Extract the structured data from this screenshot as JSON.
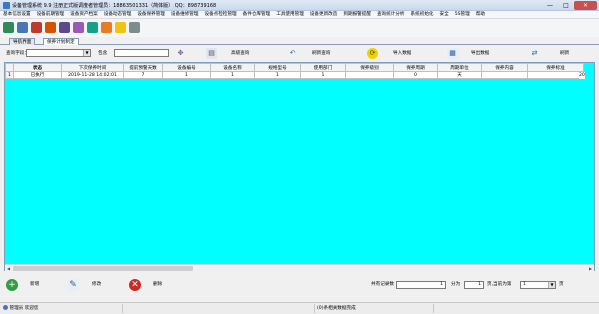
{
  "window": {
    "title": "设备管理系统 9.9   注册正式版调度者管理员：18863501331（简体版）       QQ：898739168",
    "min": "—",
    "max": "□",
    "close": "✕"
  },
  "menu": [
    "基本信息设置",
    "设备前期管理",
    "设备资产档案",
    "设备动态管理",
    "设备保养管理",
    "设备维修管理",
    "设备点检检管理",
    "备件仓库管理",
    "工具使用管理",
    "设备更新改造",
    "到期报警提醒",
    "查询统计分析",
    "系统初始化",
    "安全",
    "5S管理",
    "帮助"
  ],
  "toolbar_icons": [
    {
      "name": "tree-icon",
      "color": "#2e8b57"
    },
    {
      "name": "users-icon",
      "color": "#4a76b8"
    },
    {
      "name": "umbrella-icon",
      "color": "#c0392b"
    },
    {
      "name": "truck-icon",
      "color": "#d35400"
    },
    {
      "name": "person-icon",
      "color": "#5b4b8a"
    },
    {
      "name": "palette-icon",
      "color": "#9b59b6"
    },
    {
      "name": "book-icon",
      "color": "#16a085"
    },
    {
      "name": "gift-icon",
      "color": "#e67e22"
    },
    {
      "name": "worker-icon",
      "color": "#f1c40f"
    },
    {
      "name": "exit-icon",
      "color": "#7f8c8d"
    }
  ],
  "tabs": [
    "导航界面",
    "保养计划制定"
  ],
  "query": {
    "field_label": "查询字段：",
    "field_value": "",
    "contains_label": "包含",
    "keyword": "",
    "advanced_label": "高级查询",
    "refresh_label": "刷新查询",
    "import_label": "导入数据",
    "export_label": "导出数据",
    "reload_label": "刷新"
  },
  "table": {
    "columns": [
      "",
      "状态",
      "下次保养时间",
      "提前预警天数",
      "设备编号",
      "设备名称",
      "规格型号",
      "使用部门",
      "保养级别",
      "保养周期",
      "周期单位",
      "保养内容",
      "保养标准"
    ],
    "rows": [
      [
        "1",
        "已执行",
        "2019-11-28 14:02:01",
        "7",
        "1",
        "1",
        "1",
        "1",
        "",
        "0",
        "天",
        "",
        ""
      ]
    ],
    "overflow_text": "20"
  },
  "bottom": {
    "add_label": "新增",
    "edit_label": "修改",
    "delete_label": "删除",
    "total_label": "共有记录数",
    "total_value": "1",
    "pages_label": "分为",
    "pages_value": "1",
    "page_unit": "页,当前为第",
    "current_page": "1",
    "page_suffix": "页"
  },
  "status": {
    "user": "管理员 欢迎您",
    "center": "(0)条相关数据完成"
  }
}
